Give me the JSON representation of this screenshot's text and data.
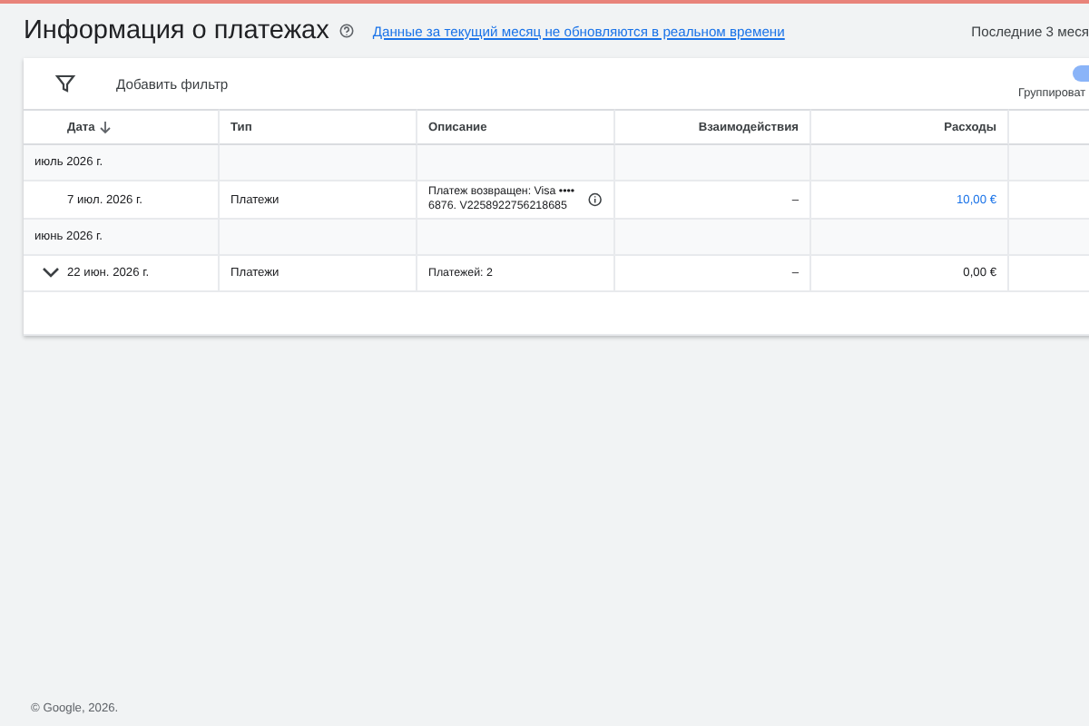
{
  "header": {
    "title": "Информация о платежах",
    "notice_link": "Данные за текущий месяц не обновляются в реальном времени",
    "date_range": "Последние 3 меся"
  },
  "toolbar": {
    "add_filter": "Добавить фильтр",
    "group_toggle": {
      "label": "Группироват",
      "on": true
    }
  },
  "table": {
    "columns": [
      {
        "label": "Дата",
        "sorted": true
      },
      {
        "label": "Тип",
        "sorted": false
      },
      {
        "label": "Описание",
        "sorted": false
      },
      {
        "label": "Взаимодействия",
        "sorted": false
      },
      {
        "label": "Расходы",
        "sorted": false
      }
    ],
    "rows": [
      {
        "kind": "month",
        "label": "июль 2026 г."
      },
      {
        "kind": "payment",
        "date": "7 июл. 2026 г.",
        "type": "Платежи",
        "description": "Платеж возвращен: Visa •••• 6876. V2258922756218685",
        "info": true,
        "interactions": "–",
        "cost": "10,00 €",
        "cost_link": true
      },
      {
        "kind": "month",
        "label": "июнь 2026 г."
      },
      {
        "kind": "group",
        "date": "22 июн. 2026 г.",
        "type": "Платежи",
        "description": "Платежей: 2",
        "interactions": "–",
        "cost": "0,00 €",
        "cost_link": false
      }
    ]
  },
  "footer": "© Google, 2026."
}
